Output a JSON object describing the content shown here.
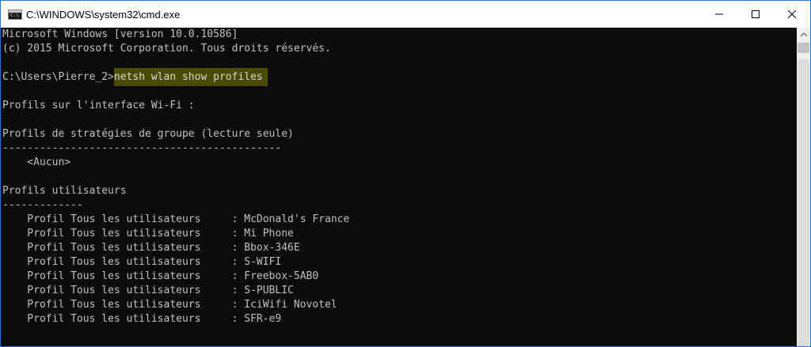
{
  "window": {
    "title": "C:\\WINDOWS\\system32\\cmd.exe",
    "icon_text": "C:\\",
    "controls": [
      "minimize-icon",
      "maximize-icon",
      "close-icon"
    ]
  },
  "console": {
    "header": {
      "version": "Microsoft Windows [version 10.0.10586]",
      "copyright": "(c) 2015 Microsoft Corporation. Tous droits réservés."
    },
    "prompt": "C:\\Users\\Pierre_2>",
    "command": "netsh wlan show profiles",
    "interface_line": "Profils sur l'interface Wi-Fi :",
    "group_heading": "Profils de stratégies de groupe (lecture seule)",
    "group_divider": "---------------------------------------------",
    "group_none": "    <Aucun>",
    "user_heading": "Profils utilisateurs",
    "user_divider": "-------------",
    "profile_label": "    Profil Tous les utilisateurs     : ",
    "profiles": [
      "McDonald's France",
      "Mi Phone",
      "Bbox-346E",
      "S-WIFI",
      "Freebox-5AB0",
      "S-PUBLIC",
      "IciWifi Novotel",
      "SFR-e9"
    ]
  },
  "colors": {
    "console_bg": "#0c0c0c",
    "console_text": "#c0c0c0",
    "highlight": "#4b4b00",
    "window_border": "#1f77d8"
  }
}
